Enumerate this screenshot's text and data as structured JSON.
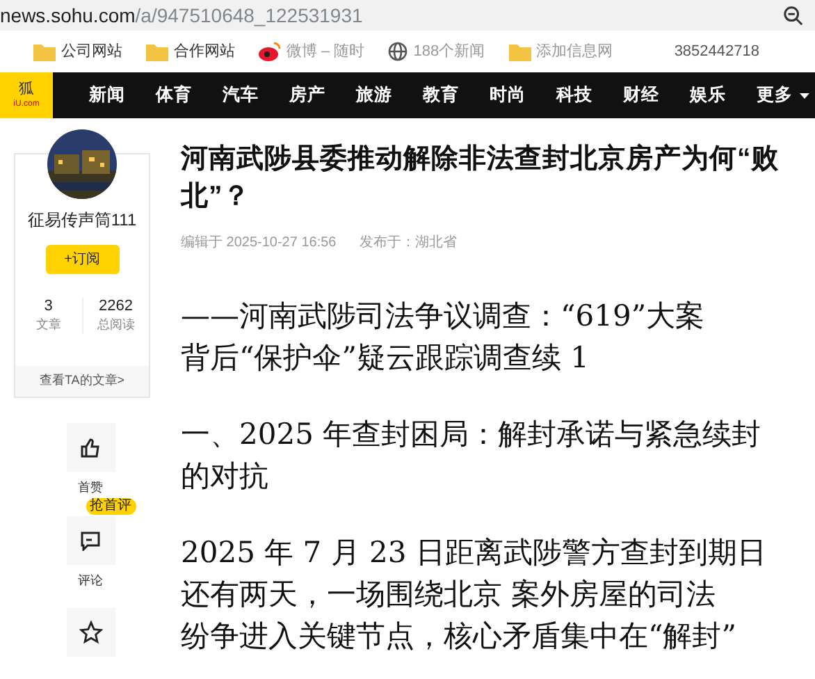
{
  "address_bar": {
    "host": "news.sohu.com",
    "path": "/a/947510648_122531931"
  },
  "bookmarks": [
    {
      "label": "公司网站",
      "kind": "folder",
      "faded": false
    },
    {
      "label": "合作网站",
      "kind": "folder",
      "faded": false
    },
    {
      "label": "微博 – 随时",
      "kind": "weibo",
      "faded": true
    },
    {
      "label": "188个新闻",
      "kind": "globe",
      "faded": true
    },
    {
      "label": "添加信息网",
      "kind": "folder",
      "faded": true
    }
  ],
  "bookmark_extra": "3852442718",
  "logo": {
    "top": "狐",
    "bottom": "iU.com"
  },
  "nav": {
    "items": [
      "新闻",
      "体育",
      "汽车",
      "房产",
      "旅游",
      "教育",
      "时尚",
      "科技",
      "财经",
      "娱乐"
    ],
    "more": "更多"
  },
  "author": {
    "name": "征易传声筒111",
    "follow": "+订阅",
    "stats": [
      {
        "value": "3",
        "label": "文章"
      },
      {
        "value": "2262",
        "label": "总阅读"
      }
    ],
    "link": "查看TA的文章>"
  },
  "actions": [
    {
      "kind": "like",
      "label": "首赞"
    },
    {
      "kind": "comment",
      "label": "评论",
      "badge": "抢首评"
    },
    {
      "kind": "star"
    }
  ],
  "article": {
    "title": [
      "河南武陟县委推动解除非法查封北京房产为何“败",
      "北”？"
    ],
    "edited": "编辑于 2025-10-27 16:56",
    "published": "发布于：湖北省",
    "paragraphs": [
      [
        "——河南武陟司法争议调查：“619”大案",
        "背后“保护伞”疑云跟踪调查续 1"
      ],
      [
        "一、2025 年查封困局：解封承诺与紧急续封",
        "的对抗"
      ],
      [
        "2025 年 7 月 23 日距离武陟警方查封到期日",
        "还有两天，一场围绕北京 案外房屋的司法",
        "纷争进入关键节点，核心矛盾集中在“解封”"
      ]
    ]
  }
}
